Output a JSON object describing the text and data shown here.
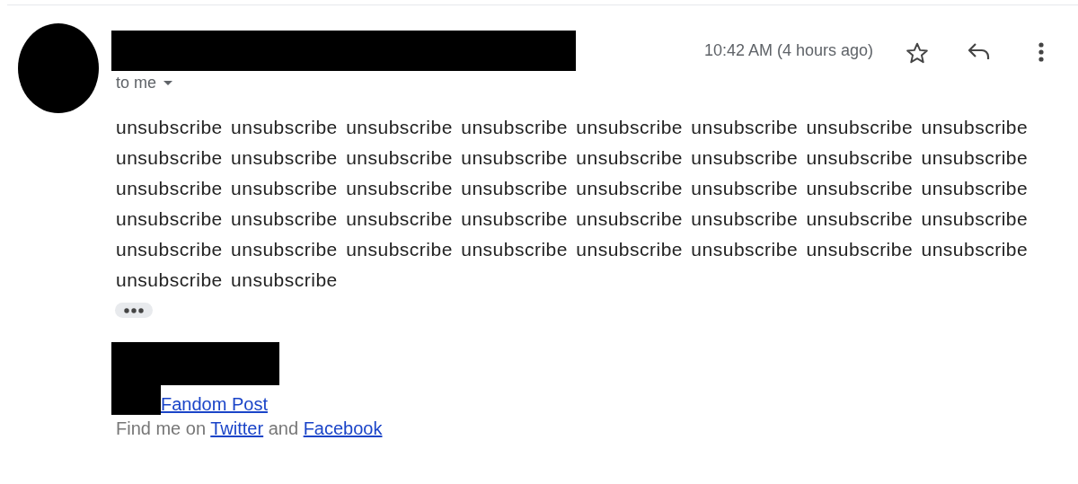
{
  "message": {
    "recipient_label": "to me",
    "time": "10:42 AM (4 hours ago)",
    "body": "unsubscribe unsubscribe unsubscribe unsubscribe unsubscribe unsubscribe unsubscribe unsubscribe unsubscribe unsubscribe unsubscribe unsubscribe unsubscribe unsubscribe unsubscribe unsubscribe unsubscribe unsubscribe unsubscribe unsubscribe unsubscribe unsubscribe unsubscribe unsubscribe unsubscribe unsubscribe unsubscribe unsubscribe unsubscribe unsubscribe unsubscribe unsubscribe unsubscribe unsubscribe unsubscribe unsubscribe unsubscribe unsubscribe unsubscribe unsubscribe unsubscribe unsubscribe",
    "starred": false
  },
  "signature": {
    "link": "Fandom Post",
    "social": {
      "prefix": "Find me on",
      "first_link": "Twitter",
      "joiner": "and",
      "second_link": "Facebook"
    }
  }
}
